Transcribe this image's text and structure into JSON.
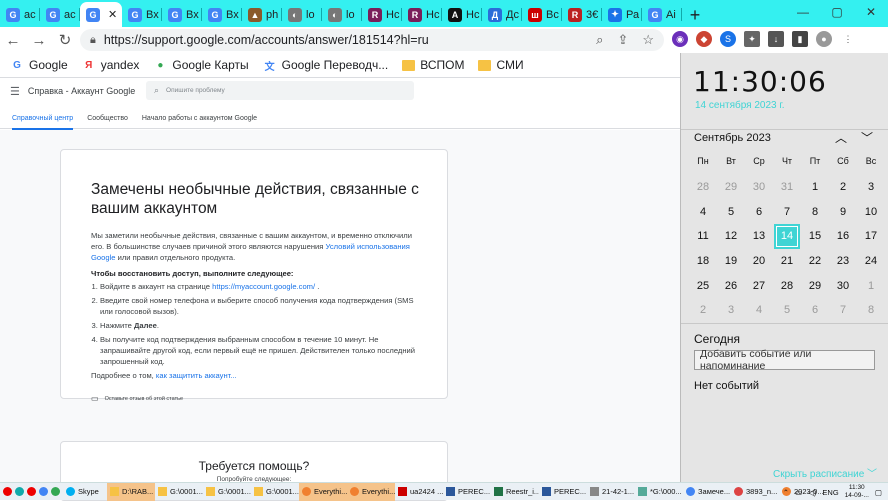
{
  "browser": {
    "tabs": [
      {
        "label": "ac",
        "icon": "google-icon",
        "color": "#4285f4",
        "glyph": "G"
      },
      {
        "label": "ac",
        "icon": "google-icon",
        "color": "#4285f4",
        "glyph": "G"
      },
      {
        "label": "",
        "icon": "google-icon",
        "color": "#4285f4",
        "glyph": "G",
        "active": true
      },
      {
        "label": "Вх",
        "icon": "google-icon",
        "color": "#4285f4",
        "glyph": "G"
      },
      {
        "label": "Вх",
        "icon": "google-icon",
        "color": "#4285f4",
        "glyph": "G"
      },
      {
        "label": "Вх",
        "icon": "google-icon",
        "color": "#4285f4",
        "glyph": "G"
      },
      {
        "label": "ph",
        "icon": "photo-icon",
        "color": "#8a5a2b",
        "glyph": "▲"
      },
      {
        "label": "lo",
        "icon": "globe-icon",
        "color": "#777",
        "glyph": "◐"
      },
      {
        "label": "lo",
        "icon": "globe-icon",
        "color": "#777",
        "glyph": "◐"
      },
      {
        "label": "Нс",
        "icon": "reestr-icon",
        "color": "#7a1f5a",
        "glyph": "R"
      },
      {
        "label": "Нс",
        "icon": "reestr-icon",
        "color": "#7a1f5a",
        "glyph": "R"
      },
      {
        "label": "Нс",
        "icon": "a-icon",
        "color": "#111",
        "glyph": "A"
      },
      {
        "label": "Дс",
        "icon": "docs-icon",
        "color": "#2a6dd9",
        "glyph": "Д"
      },
      {
        "label": "Вс",
        "icon": "chart-icon",
        "color": "#c00",
        "glyph": "ш"
      },
      {
        "label": "3€",
        "icon": "raz-icon",
        "color": "#b22",
        "glyph": "R"
      },
      {
        "label": "Ра",
        "icon": "puzzle-icon",
        "color": "#1a73e8",
        "glyph": "✦"
      },
      {
        "label": "Аі",
        "icon": "google-icon",
        "color": "#4285f4",
        "glyph": "G"
      }
    ],
    "new_tab": "+",
    "url": "https://support.google.com/accounts/answer/181514?hl=ru"
  },
  "bookmarks": [
    {
      "label": "Google",
      "icon": "google-icon",
      "color": "#4285f4",
      "glyph": "G"
    },
    {
      "label": "yandex",
      "icon": "yandex-icon",
      "color": "#e33",
      "glyph": "Я"
    },
    {
      "label": "Google Карты",
      "icon": "maps-icon",
      "color": "#34a853",
      "glyph": "●"
    },
    {
      "label": "Google Переводч...",
      "icon": "translate-icon",
      "color": "#4285f4",
      "glyph": "文"
    },
    {
      "label": "ВСПОМ",
      "icon": "folder-icon",
      "color": "#f6c244",
      "glyph": ""
    },
    {
      "label": "СМИ",
      "icon": "folder-icon",
      "color": "#f6c244",
      "glyph": ""
    }
  ],
  "help": {
    "header_title": "Справка - Аккаунт Google",
    "search_placeholder": "Опишите проблему",
    "tabs": [
      "Справочный центр",
      "Сообщество",
      "Начало работы с аккаунтом Google"
    ],
    "article": {
      "title": "Замечены необычные действия, связанные с вашим аккаунтом",
      "intro": "Мы заметили необычные действия, связанные с вашим аккаунтом, и временно отключили его. В большинстве случаев причиной этого являются нарушения",
      "intro_link": "Условий использования Google",
      "intro_end": "или правил отдельного продукта.",
      "restore_heading": "Чтобы восстановить доступ, выполните следующее:",
      "step1_text": "Войдите в аккаунт на странице",
      "step1_link": "https://myaccount.google.com/",
      "step2": "Введите свой номер телефона и выберите способ получения кода подтверждения (SMS или голосовой вызов).",
      "step3_prefix": "Нажмите",
      "step3_bold": "Далее",
      "step4": "Вы получите код подтверждения выбранным способом в течение 10 минут. Не запрашивайте другой код, если первый ещё не пришел. Действителен только последний запрошенный код.",
      "more_prefix": "Подробнее о том,",
      "more_link": "как защитить аккаунт...",
      "feedback": "Оставьте отзыв об этой статье"
    },
    "help_card": {
      "title": "Требуется помощь?",
      "subtitle": "Попробуйте следующее:"
    }
  },
  "calendar": {
    "time": "11:30:06",
    "date": "14 сентября 2023 г.",
    "month": "Сентябрь 2023",
    "weekdays": [
      "Пн",
      "Вт",
      "Ср",
      "Чт",
      "Пт",
      "Сб",
      "Вс"
    ],
    "days": [
      [
        "28",
        "29",
        "30",
        "31",
        "1",
        "2",
        "3"
      ],
      [
        "4",
        "5",
        "6",
        "7",
        "8",
        "9",
        "10"
      ],
      [
        "11",
        "12",
        "13",
        "14",
        "15",
        "16",
        "17"
      ],
      [
        "18",
        "19",
        "20",
        "21",
        "22",
        "23",
        "24"
      ],
      [
        "25",
        "26",
        "27",
        "28",
        "29",
        "30",
        "1"
      ],
      [
        "2",
        "3",
        "4",
        "5",
        "6",
        "7",
        "8"
      ]
    ],
    "today": "14",
    "today_label": "Сегодня",
    "add_event": "Добавить событие или напоминание",
    "no_events": "Нет событий",
    "hide_schedule": "Скрыть расписание"
  },
  "taskbar": {
    "items": [
      {
        "label": "Skype",
        "color": "#00aff0",
        "shape": "ic"
      },
      {
        "label": "D:\\RAB...",
        "color": "#f6c244",
        "shape": "sq",
        "hl": true
      },
      {
        "label": "G:\\0001...",
        "color": "#f6c244",
        "shape": "sq"
      },
      {
        "label": "G:\\0001...",
        "color": "#f6c244",
        "shape": "sq"
      },
      {
        "label": "G:\\0001...",
        "color": "#f6c244",
        "shape": "sq"
      },
      {
        "label": "Everythi...",
        "color": "#f08030",
        "shape": "ic",
        "hl": true
      },
      {
        "label": "Everythi...",
        "color": "#f08030",
        "shape": "ic",
        "hl": true
      },
      {
        "label": "ua2424 ...",
        "color": "#c00",
        "shape": "sq"
      },
      {
        "label": "PEREC...",
        "color": "#2b579a",
        "shape": "sq"
      },
      {
        "label": "Reestr_i...",
        "color": "#217346",
        "shape": "sq"
      },
      {
        "label": "PEREC...",
        "color": "#2b579a",
        "shape": "sq"
      },
      {
        "label": "21-42-1...",
        "color": "#888",
        "shape": "sq"
      },
      {
        "label": "*G:\\000...",
        "color": "#5a9",
        "shape": "sq"
      },
      {
        "label": "Замече...",
        "color": "#4285f4",
        "shape": "ic"
      },
      {
        "label": "3893_n...",
        "color": "#d44",
        "shape": "ic"
      },
      {
        "label": "2023-0...",
        "color": "#f08030",
        "shape": "ic"
      }
    ],
    "lang": "ENG",
    "clock_time": "11:30",
    "clock_date": "14-09-..."
  }
}
